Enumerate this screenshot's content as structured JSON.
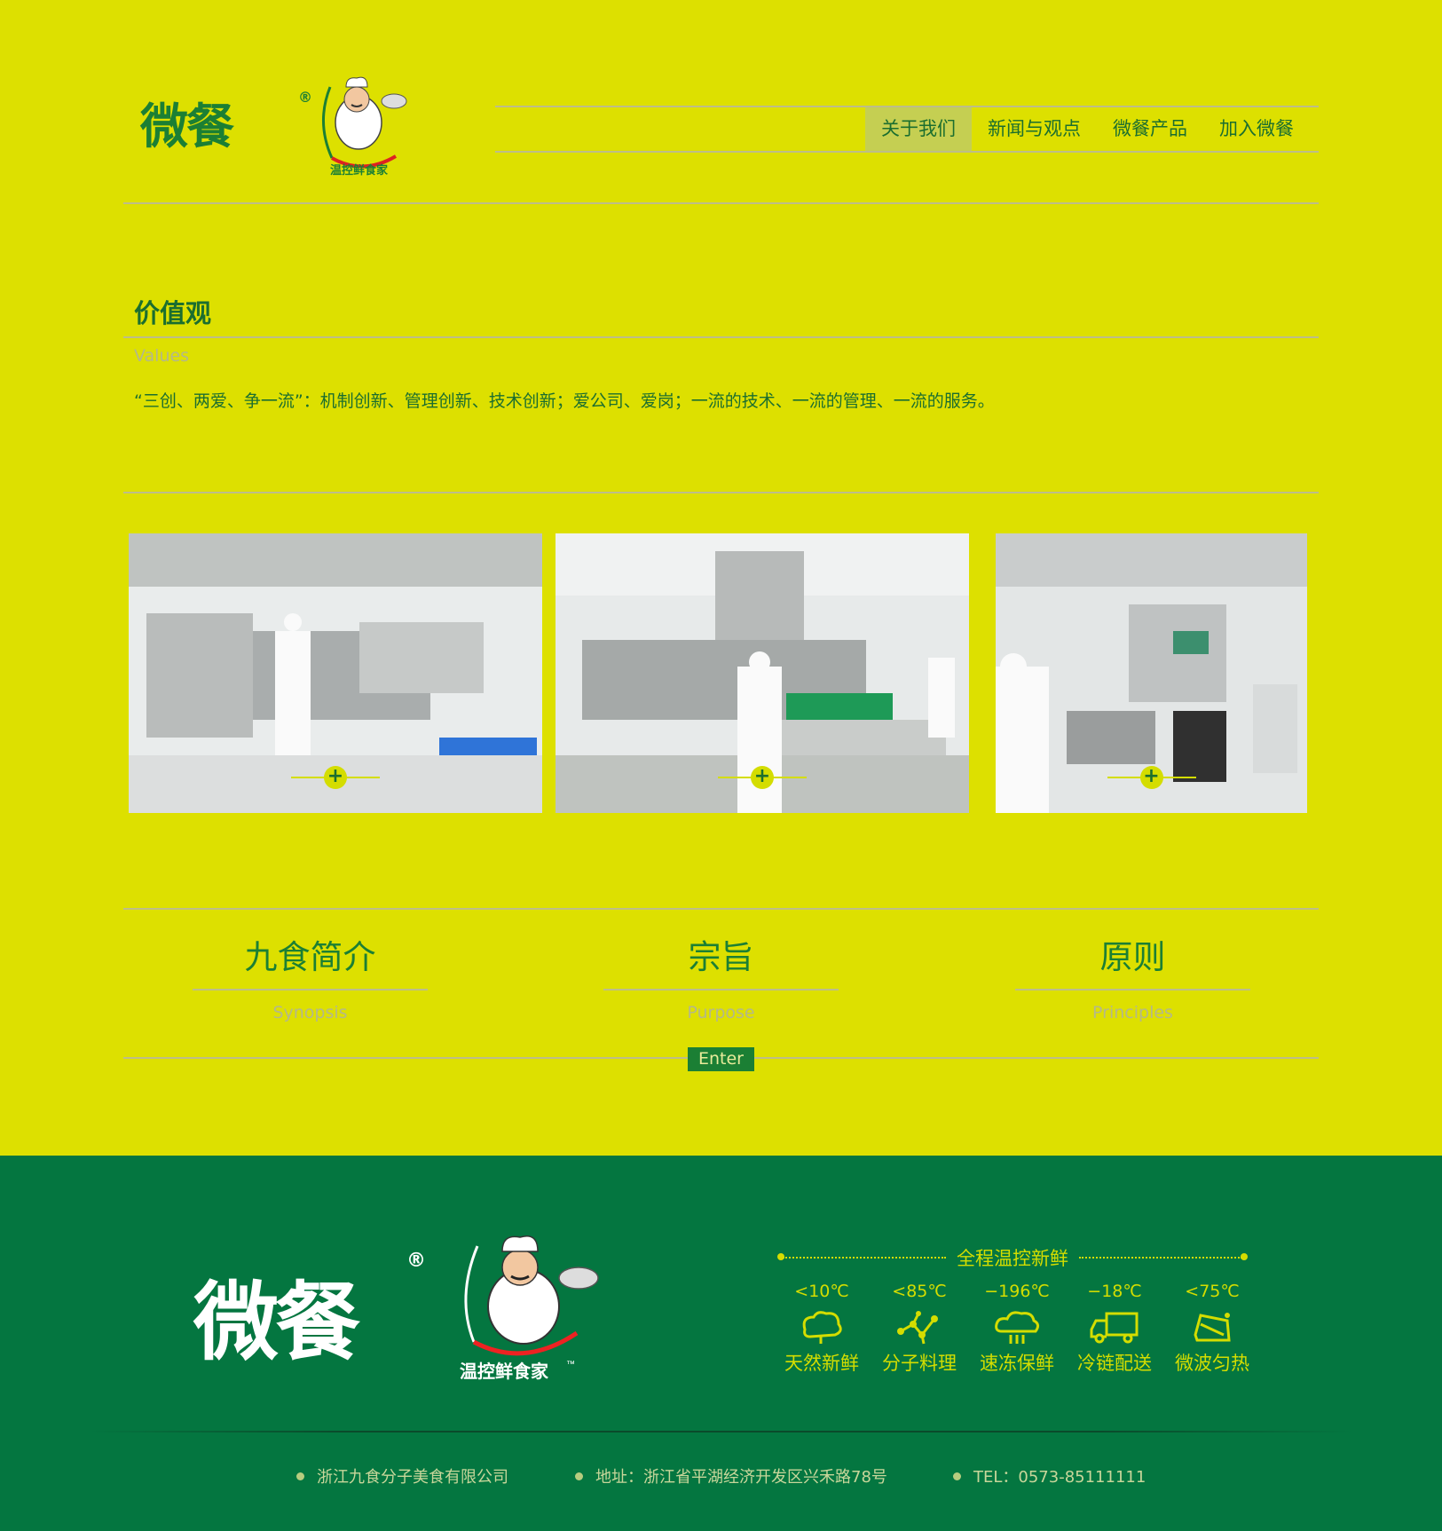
{
  "header": {
    "logo_text": "微餐",
    "logo_reg": "®",
    "badge_text": "温控鲜食家",
    "nav": [
      {
        "label": "关于我们",
        "active": true
      },
      {
        "label": "新闻与观点",
        "active": false
      },
      {
        "label": "微餐产品",
        "active": false
      },
      {
        "label": "加入微餐",
        "active": false
      }
    ]
  },
  "values": {
    "title": "价值观",
    "subtitle": "Values",
    "body": "“三创、两爱、争一流”：机制创新、管理创新、技术创新；爱公司、爱岗；一流的技术、一流的管理、一流的服务。"
  },
  "photos": [
    {
      "alt": "food production line worker"
    },
    {
      "alt": "packaging station workers"
    },
    {
      "alt": "control panel machine"
    }
  ],
  "about": {
    "columns": [
      {
        "title": "九食简介",
        "subtitle": "Synopsis"
      },
      {
        "title": "宗旨",
        "subtitle": "Purpose"
      },
      {
        "title": "原则",
        "subtitle": "Principles"
      }
    ],
    "enter_label": "Enter"
  },
  "footer": {
    "logo_text": "微餐",
    "logo_reg": "®",
    "badge_text": "温控鲜食家",
    "badge_tm": "™",
    "temp_title": "全程温控新鲜",
    "temps": [
      {
        "temp": "<10℃",
        "label": "天然新鲜",
        "icon": "vegetable-icon"
      },
      {
        "temp": "<85℃",
        "label": "分子料理",
        "icon": "molecule-icon"
      },
      {
        "temp": "−196℃",
        "label": "速冻保鲜",
        "icon": "cloud-freeze-icon"
      },
      {
        "temp": "−18℃",
        "label": "冷链配送",
        "icon": "truck-icon"
      },
      {
        "temp": "<75℃",
        "label": "微波匀热",
        "icon": "microwave-icon"
      }
    ],
    "company": "浙江九食分子美食有限公司",
    "address": "地址：浙江省平湖经济开发区兴禾路78号",
    "tel": "TEL：0573-85111111",
    "colors": {
      "accent": "#d4dd00",
      "bg": "#047640"
    }
  }
}
